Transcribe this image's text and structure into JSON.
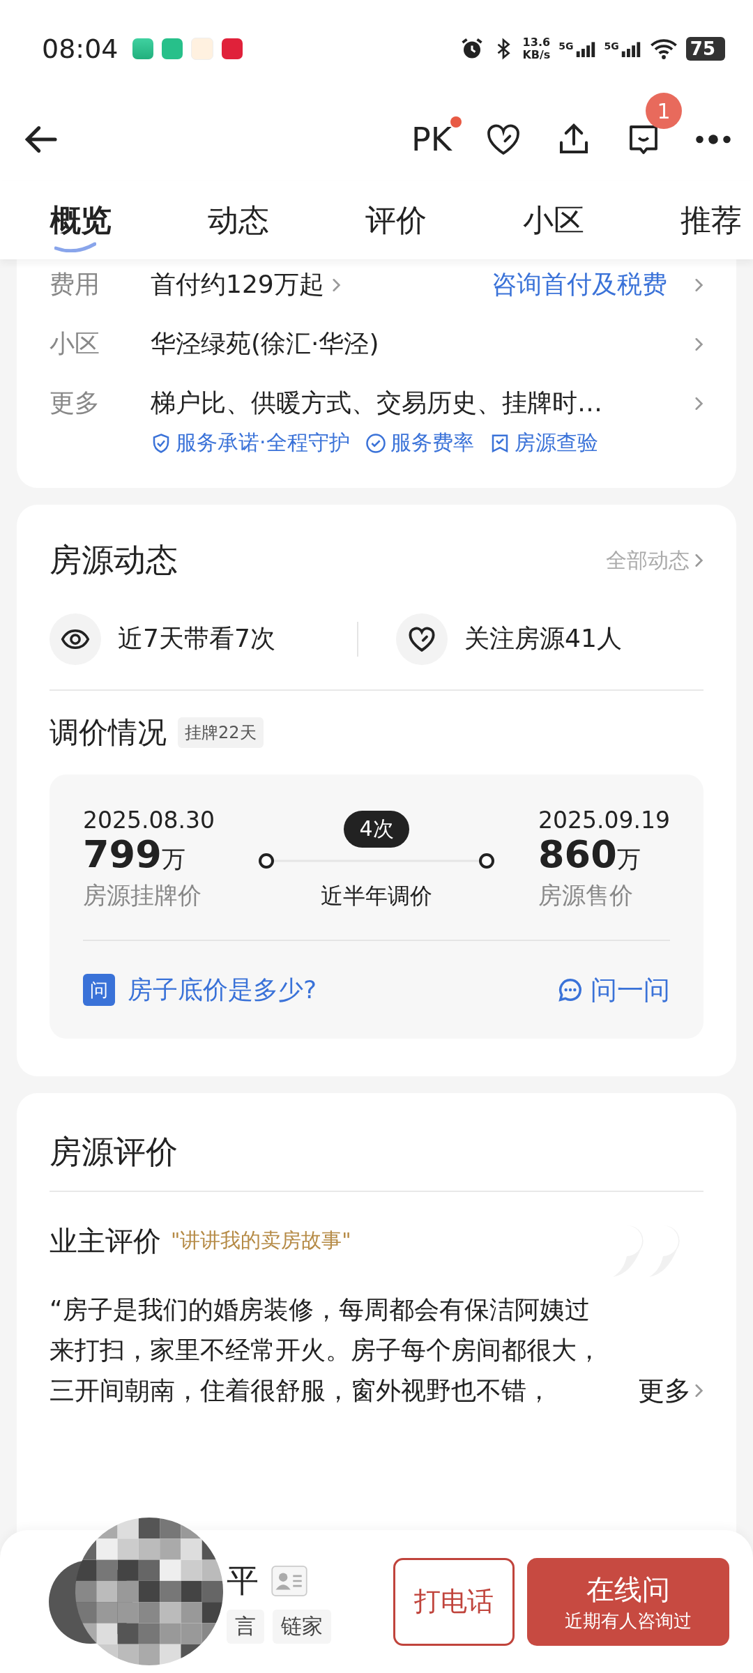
{
  "status_bar": {
    "time": "08:04",
    "speed": "13.6",
    "speed_unit": "KB/s",
    "networks": [
      "5G",
      "5G"
    ],
    "battery": "75"
  },
  "header": {
    "pk": "PK",
    "pk_dot": true,
    "message_badge": "1"
  },
  "tabs": [
    {
      "label": "概览",
      "selected": true
    },
    {
      "label": "动态",
      "selected": false
    },
    {
      "label": "评价",
      "selected": false
    },
    {
      "label": "小区",
      "selected": false
    },
    {
      "label": "推荐",
      "selected": false
    }
  ],
  "info_rows": [
    {
      "label": "费用",
      "value": "首付约129万起",
      "link": "咨询首付及税费"
    },
    {
      "label": "小区",
      "value": "华泾绿苑(徐汇·华泾)"
    },
    {
      "label": "更多",
      "value": "梯户比、供暖方式、交易历史、挂牌时…"
    }
  ],
  "services": [
    {
      "kind": "shield",
      "label": "服务承诺·全程守护"
    },
    {
      "kind": "check",
      "label": "服务费率"
    },
    {
      "kind": "inspect",
      "label": "房源查验"
    }
  ],
  "dynamics": {
    "title": "房源动态",
    "more": "全部动态",
    "stats": [
      {
        "kind": "eye",
        "text": "近7天带看7次"
      },
      {
        "kind": "heart",
        "text": "关注房源41人"
      }
    ]
  },
  "price_change": {
    "title": "调价情况",
    "tag": "挂牌22天",
    "start": {
      "date": "2025.08.30",
      "price": "799",
      "unit": "万",
      "label": "房源挂牌价"
    },
    "count": "4次",
    "period": "近半年调价",
    "end": {
      "date": "2025.09.19",
      "price": "860",
      "unit": "万",
      "label": "房源售价"
    },
    "question_badge": "问",
    "question": "房子底价是多少?",
    "ask": "问一问"
  },
  "reviews": {
    "title": "房源评价",
    "owner_title": "业主评价",
    "prompt": "\"讲讲我的卖房故事\"",
    "text": "“房子是我们的婚房装修，每周都会有保洁阿姨过来打扫，家里不经常开火。房子每个房间都很大，三开间朝南，住着很舒服，窗外视野也不错，",
    "more": "更多"
  },
  "agent": {
    "name": "平",
    "tags": [
      "言",
      "链家"
    ],
    "call": "打电话",
    "online": "在线问",
    "online_sub": "近期有人咨询过"
  }
}
